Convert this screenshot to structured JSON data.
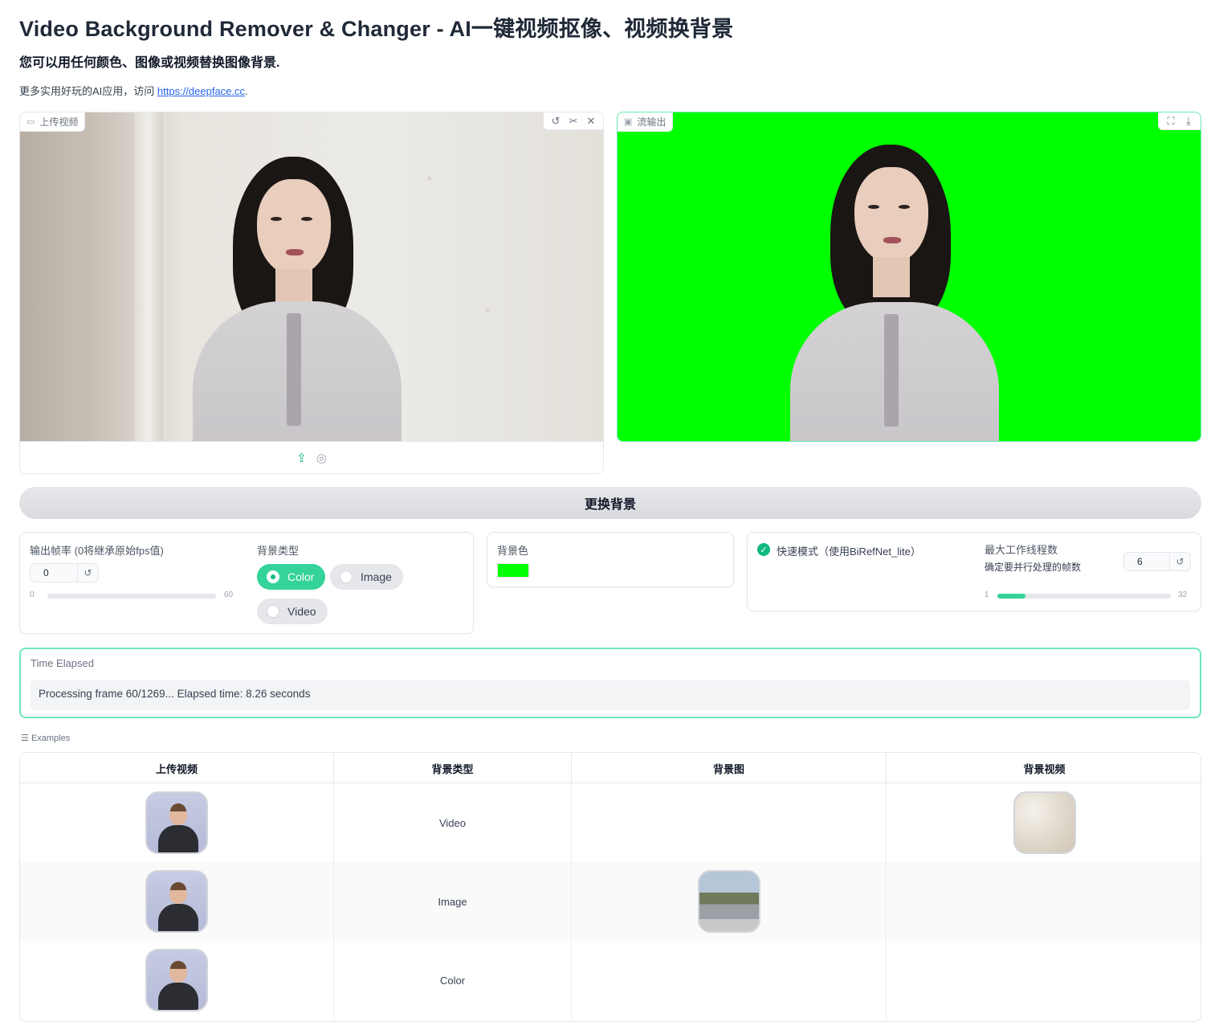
{
  "header": {
    "title": "Video Background Remover & Changer - AI一键视频抠像、视频换背景",
    "subtitle": "您可以用任何颜色、图像或视频替换图像背景.",
    "more_prefix": "更多实用好玩的AI应用，访问 ",
    "more_link": "https://deepface.cc",
    "more_suffix": "."
  },
  "input_panel": {
    "label": "上传视频",
    "label_icon": "video-camera-icon",
    "tools": [
      "undo-icon",
      "scissors-icon",
      "close-icon"
    ],
    "bottom_buttons": [
      "upload-icon",
      "webcam-icon"
    ]
  },
  "output_panel": {
    "label": "流输出",
    "label_icon": "image-icon",
    "tools": [
      "fullscreen-icon",
      "download-icon"
    ]
  },
  "run_button": "更换背景",
  "fps": {
    "label": "输出帧率 (0将继承原始fps值)",
    "value": "0",
    "min": "0",
    "max": "60",
    "fraction": 0.0
  },
  "bg_type": {
    "label": "背景类型",
    "options": [
      "Color",
      "Image",
      "Video"
    ],
    "selected": "Color"
  },
  "bg_color": {
    "label": "背景色",
    "value": "#00ff00"
  },
  "fast_mode": {
    "label": "快速模式（使用BiRefNet_lite）",
    "checked": true
  },
  "workers": {
    "label": "最大工作线程数",
    "sublabel": "确定要并行处理的帧数",
    "value": "6",
    "min": "1",
    "max": "32",
    "fraction": 0.16
  },
  "elapsed": {
    "label": "Time Elapsed",
    "text": "Processing frame 60/1269... Elapsed time: 8.26 seconds"
  },
  "examples": {
    "label": "Examples",
    "columns": [
      "上传视频",
      "背景类型",
      "背景图",
      "背景视频"
    ],
    "rows": [
      {
        "bg_type": "Video",
        "bg_image": "",
        "bg_video": "paper"
      },
      {
        "bg_type": "Image",
        "bg_image": "town",
        "bg_video": ""
      },
      {
        "bg_type": "Color",
        "bg_image": "",
        "bg_video": ""
      }
    ]
  },
  "colors": {
    "accent": "#34d399",
    "accent_dark": "#10b981",
    "green_screen": "#00ff00"
  }
}
